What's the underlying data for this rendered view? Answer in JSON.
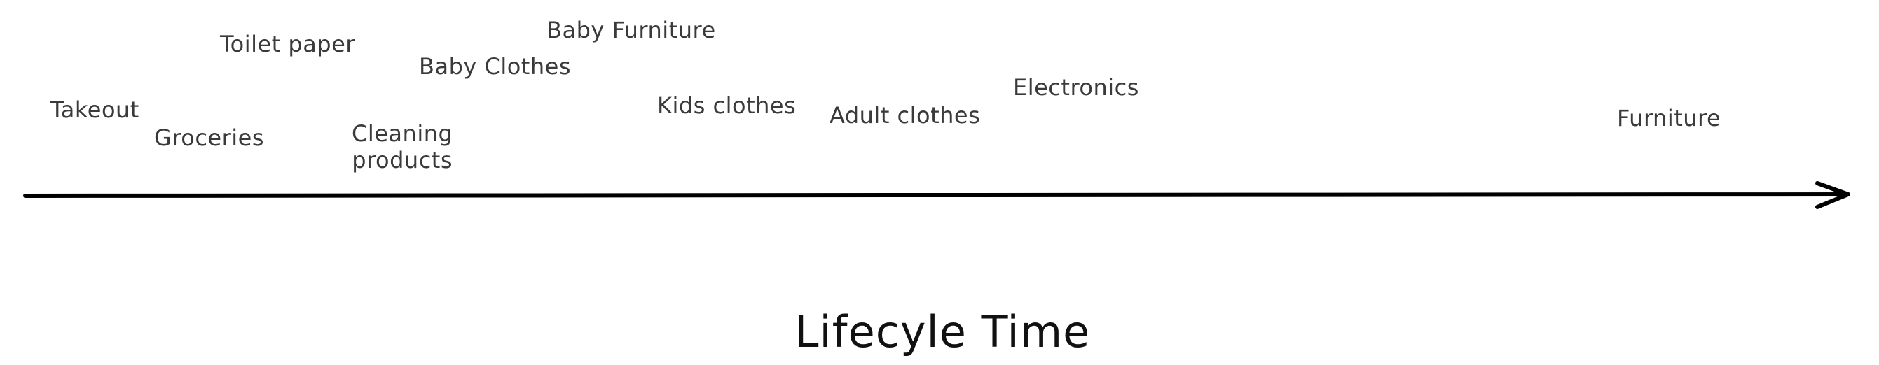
{
  "axis": {
    "title": "Lifecyle Time"
  },
  "items": [
    {
      "label": "Takeout"
    },
    {
      "label": "Groceries"
    },
    {
      "label": "Toilet paper"
    },
    {
      "label": "Cleaning\nproducts"
    },
    {
      "label": "Baby Clothes"
    },
    {
      "label": "Baby Furniture"
    },
    {
      "label": "Kids clothes"
    },
    {
      "label": "Adult clothes"
    },
    {
      "label": "Electronics"
    },
    {
      "label": "Furniture"
    }
  ],
  "colors": {
    "label_text": "#3a3a3a",
    "axis_line": "#000000",
    "title_text": "#111111"
  }
}
